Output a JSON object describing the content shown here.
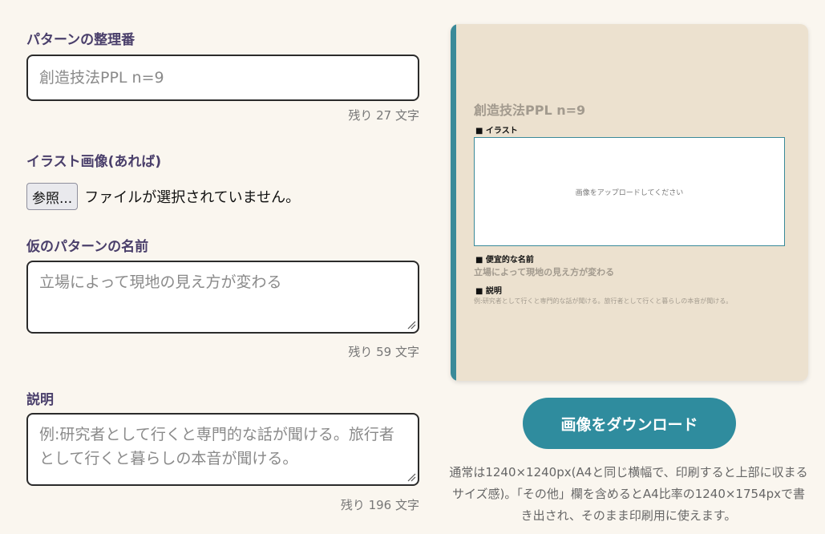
{
  "form": {
    "pattern_number": {
      "label": "パターンの整理番",
      "placeholder": "創造技法PPL n=9",
      "counter": "残り 27 文字"
    },
    "illustration": {
      "label": "イラスト画像(あれば)",
      "button_label": "参照...",
      "status": "ファイルが選択されていません。"
    },
    "temp_name": {
      "label": "仮のパターンの名前",
      "placeholder": "立場によって現地の見え方が変わる",
      "counter": "残り 59 文字"
    },
    "description": {
      "label": "説明",
      "placeholder": "例:研究者として行くと専門的な話が聞ける。旅行者として行くと暮らしの本音が聞ける。",
      "counter": "残り 196 文字"
    }
  },
  "preview": {
    "title": "創造技法PPL n=9",
    "illustration_heading": "■ イラスト",
    "image_placeholder": "画像をアップロードしてください",
    "name_heading": "■ 便宜的な名前",
    "name_text": "立場によって現地の見え方が変わる",
    "description_heading": "■ 説明",
    "description_text": "例:研究者として行くと専門的な話が聞ける。旅行者として行くと暮らしの本音が聞ける。"
  },
  "download": {
    "label": "画像をダウンロード"
  },
  "note": {
    "text": "通常は1240×1240px(A4と同じ横幅で、印刷すると上部に収まるサイズ感)。「その他」欄を含めるとA4比率の1240×1754pxで書き出され、そのまま印刷用に使えます。"
  },
  "colors": {
    "background": "#faf6ef",
    "label": "#4a3f6b",
    "accent": "#2f8c9e",
    "preview_background": "#ece1cf",
    "preview_accent": "#3a8a99"
  }
}
